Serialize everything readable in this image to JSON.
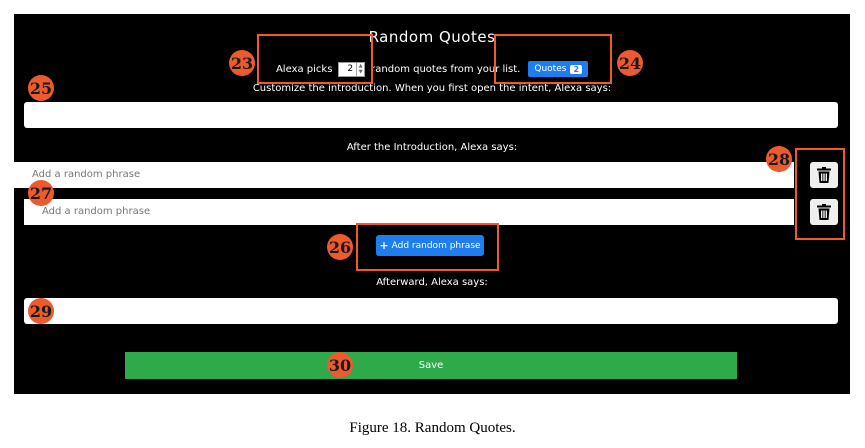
{
  "header": {
    "title": "Random Quotes"
  },
  "picker": {
    "prefix": "Alexa picks",
    "count": "2",
    "suffix": "random quotes from your list.",
    "quotes_button_label": "Quotes",
    "quotes_badge": "2"
  },
  "intro": {
    "label": "Customize the introduction. When you first open the intent, Alexa says:",
    "value": ""
  },
  "after_intro": {
    "label": "After the Introduction, Alexa says:"
  },
  "phrases": [
    {
      "placeholder": "Add a random phrase"
    },
    {
      "placeholder": "Add a random phrase"
    }
  ],
  "add_button": {
    "label": "Add random phrase",
    "icon": "plus-icon"
  },
  "afterward": {
    "label": "Afterward, Alexa says:",
    "value": ""
  },
  "save_button": {
    "label": "Save"
  },
  "annotations": [
    "23",
    "24",
    "25",
    "26",
    "27",
    "28",
    "29",
    "30"
  ],
  "caption": "Figure 18. Random Quotes.",
  "colors": {
    "panel": "#000000",
    "primary": "#1e7ef0",
    "success": "#2eaa4a",
    "annotation": "#ec5a2e"
  }
}
